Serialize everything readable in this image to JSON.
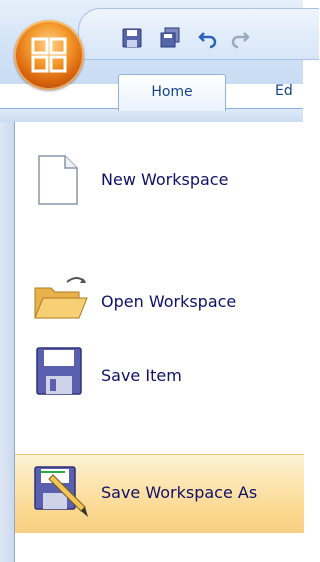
{
  "ribbon": {
    "tabs": [
      {
        "label": "Home"
      },
      {
        "label": "Ed"
      }
    ],
    "quick_access": [
      "save-icon",
      "save-all-icon",
      "undo-icon",
      "redo-icon"
    ]
  },
  "menu": {
    "items": [
      {
        "label": "New Workspace",
        "icon": "new-document-icon"
      },
      {
        "label": "Open Workspace",
        "icon": "open-folder-icon"
      },
      {
        "label": "Save Item",
        "icon": "save-floppy-icon"
      },
      {
        "label": "Save Workspace As",
        "icon": "save-as-icon",
        "highlighted": true
      }
    ]
  },
  "colors": {
    "orb": "#e07a1a",
    "menu_text": "#10106a",
    "tab_text": "#15428b",
    "highlight": "#fde2a8"
  }
}
